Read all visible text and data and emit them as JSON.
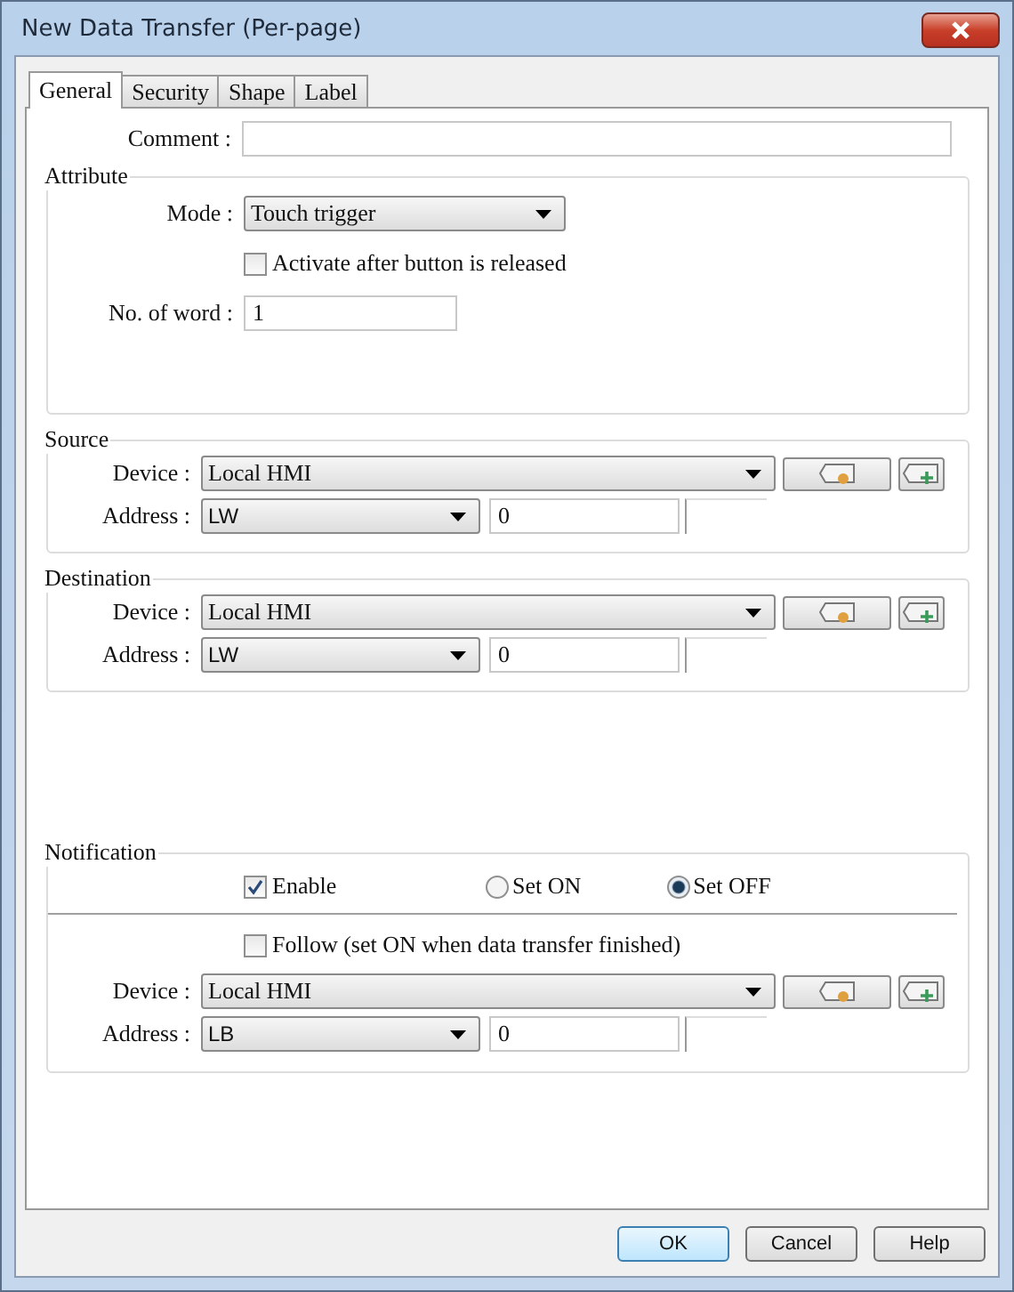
{
  "window": {
    "title": "New Data Transfer (Per-page)"
  },
  "tabs": [
    {
      "label": "General",
      "selected": true
    },
    {
      "label": "Security",
      "selected": false
    },
    {
      "label": "Shape",
      "selected": false
    },
    {
      "label": "Label",
      "selected": false
    }
  ],
  "comment": {
    "label": "Comment :"
  },
  "attribute": {
    "title": "Attribute",
    "mode": {
      "label": "Mode :",
      "value": "Touch trigger"
    },
    "activate": {
      "label": "Activate after button is released",
      "checked": false
    },
    "words": {
      "label": "No. of word :",
      "value": "1"
    }
  },
  "source": {
    "title": "Source",
    "device": {
      "label": "Device :",
      "value": "Local HMI"
    },
    "address": {
      "label": "Address :",
      "type": "LW",
      "value": "0"
    }
  },
  "destination": {
    "title": "Destination",
    "device": {
      "label": "Device :",
      "value": "Local HMI"
    },
    "address": {
      "label": "Address :",
      "type": "LW",
      "value": "0"
    }
  },
  "notification": {
    "title": "Notification",
    "enable": {
      "label": "Enable",
      "checked": true
    },
    "radios": [
      {
        "label": "Set ON",
        "selected": false
      },
      {
        "label": "Set OFF",
        "selected": true
      }
    ],
    "follow": {
      "label": "Follow (set ON when data transfer finished)",
      "checked": false
    },
    "device": {
      "label": "Device :",
      "value": "Local HMI"
    },
    "address": {
      "label": "Address :",
      "type": "LB",
      "value": "0"
    }
  },
  "buttons": [
    {
      "label": "OK",
      "default": true
    },
    {
      "label": "Cancel",
      "default": false
    },
    {
      "label": "Help",
      "default": false
    }
  ]
}
